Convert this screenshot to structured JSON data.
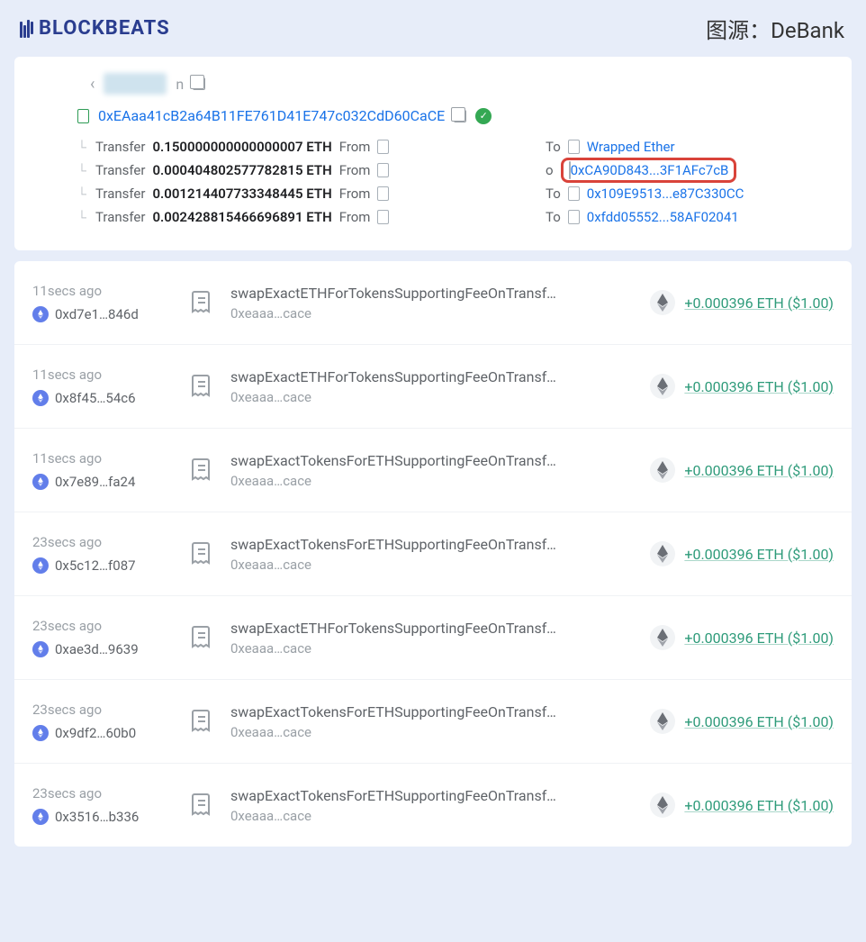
{
  "header": {
    "logo_text": "BLOCKBEATS",
    "source_label": "图源：DeBank"
  },
  "top_card": {
    "address": "0xEAaa41cB2a64B11FE761D41E747c032CdD60CaCE",
    "transfers": [
      {
        "amount": "0.150000000000000007 ETH",
        "to_label": "To",
        "dest": "Wrapped Ether",
        "highlight": false,
        "wrapped": true
      },
      {
        "amount": "0.000404802577782815 ETH",
        "to_label": "o",
        "dest": "0xCA90D843...3F1AFc7cB",
        "highlight": true,
        "wrapped": false
      },
      {
        "amount": "0.001214407733348445 ETH",
        "to_label": "To",
        "dest": "0x109E9513...e87C330CC",
        "highlight": false,
        "wrapped": false
      },
      {
        "amount": "0.002428815466696891 ETH",
        "to_label": "To",
        "dest": "0xfdd05552...58AF02041",
        "highlight": false,
        "wrapped": false
      }
    ],
    "transfer_word": "Transfer",
    "from_word": "From"
  },
  "tx_list": [
    {
      "time": "11secs ago",
      "hash": "0xd7e1…846d",
      "method": "swapExactETHForTokensSupportingFeeOnTransfe…",
      "contract": "0xeaaa…cace",
      "value": "+0.000396 ETH ($1.00)"
    },
    {
      "time": "11secs ago",
      "hash": "0x8f45…54c6",
      "method": "swapExactETHForTokensSupportingFeeOnTransfe…",
      "contract": "0xeaaa…cace",
      "value": "+0.000396 ETH ($1.00)"
    },
    {
      "time": "11secs ago",
      "hash": "0x7e89…fa24",
      "method": "swapExactTokensForETHSupportingFeeOnTransfe…",
      "contract": "0xeaaa…cace",
      "value": "+0.000396 ETH ($1.00)"
    },
    {
      "time": "23secs ago",
      "hash": "0x5c12…f087",
      "method": "swapExactTokensForETHSupportingFeeOnTransfe…",
      "contract": "0xeaaa…cace",
      "value": "+0.000396 ETH ($1.00)"
    },
    {
      "time": "23secs ago",
      "hash": "0xae3d…9639",
      "method": "swapExactETHForTokensSupportingFeeOnTransfe…",
      "contract": "0xeaaa…cace",
      "value": "+0.000396 ETH ($1.00)"
    },
    {
      "time": "23secs ago",
      "hash": "0x9df2…60b0",
      "method": "swapExactTokensForETHSupportingFeeOnTransfe…",
      "contract": "0xeaaa…cace",
      "value": "+0.000396 ETH ($1.00)"
    },
    {
      "time": "23secs ago",
      "hash": "0x3516…b336",
      "method": "swapExactTokensForETHSupportingFeeOnTransfe…",
      "contract": "0xeaaa…cace",
      "value": "+0.000396 ETH ($1.00)"
    }
  ]
}
